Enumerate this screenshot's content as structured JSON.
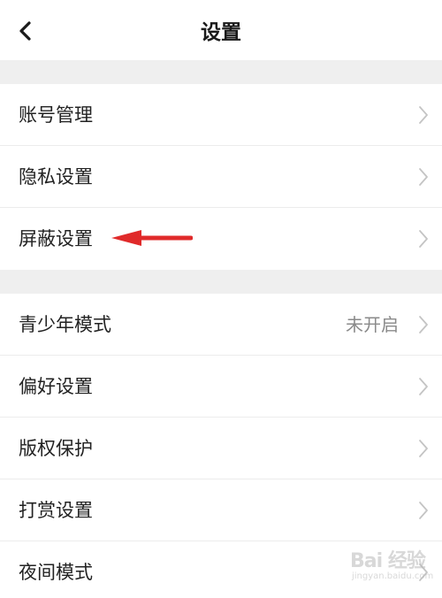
{
  "header": {
    "title": "设置",
    "back_icon": "chevron-left-icon"
  },
  "group1": [
    {
      "label": "账号管理",
      "value": ""
    },
    {
      "label": "隐私设置",
      "value": ""
    },
    {
      "label": "屏蔽设置",
      "value": ""
    }
  ],
  "group2": [
    {
      "label": "青少年模式",
      "value": "未开启"
    },
    {
      "label": "偏好设置",
      "value": ""
    },
    {
      "label": "版权保护",
      "value": ""
    },
    {
      "label": "打赏设置",
      "value": ""
    },
    {
      "label": "夜间模式",
      "value": ""
    }
  ],
  "watermark": {
    "main": "Bai 经验",
    "sub": "jingyan.baidu.com"
  },
  "colors": {
    "separator": "#efefef",
    "arrow": "#e02a2a",
    "chevron": "#c4c4c4",
    "secondary_text": "#8a8a8a"
  }
}
